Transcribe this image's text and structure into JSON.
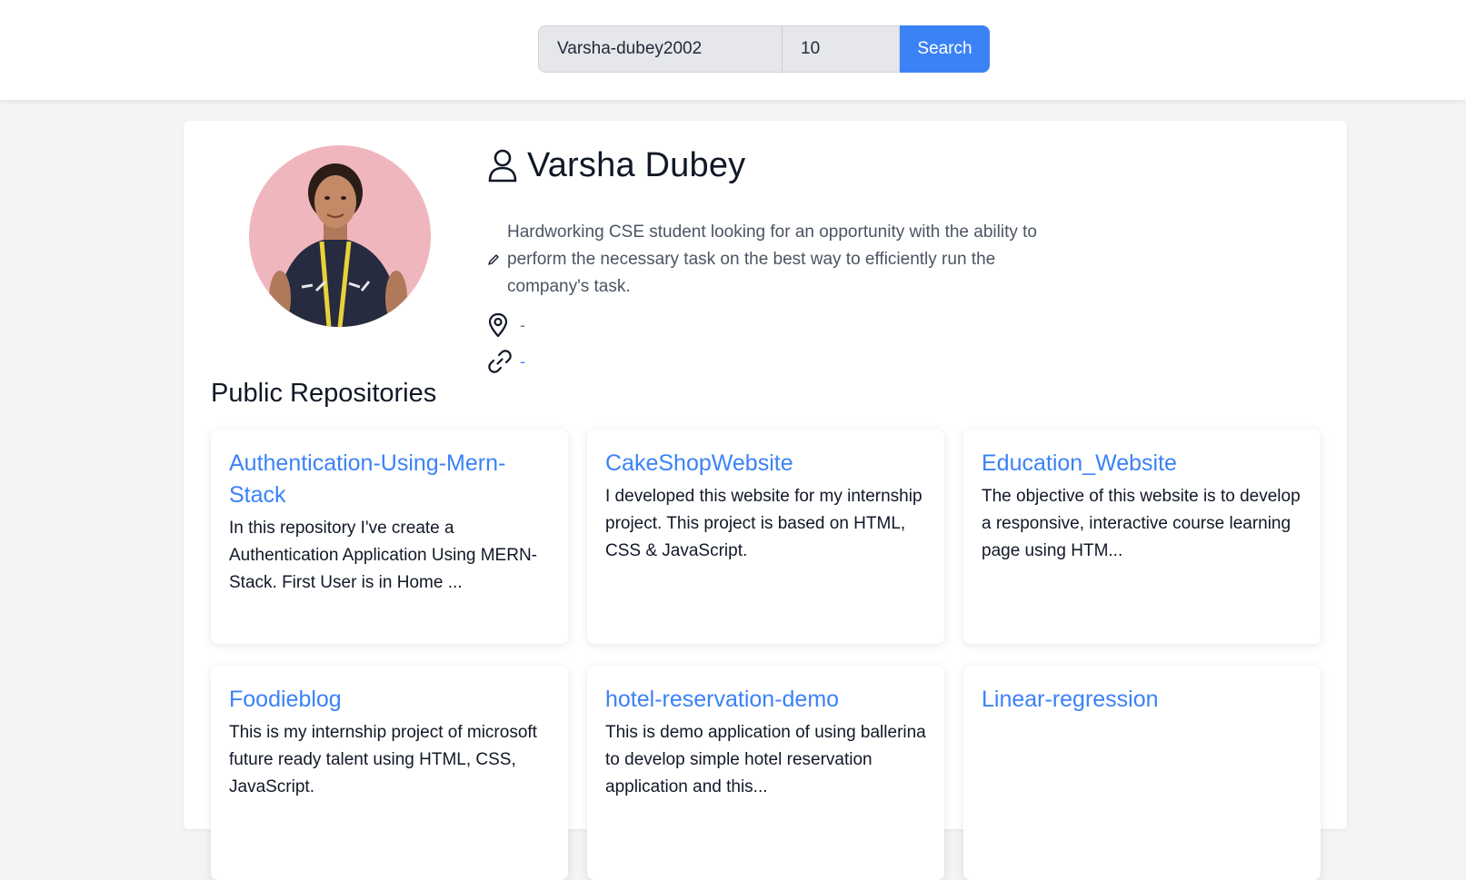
{
  "search": {
    "username_value": "Varsha-dubey2002",
    "count_value": "10",
    "button_label": "Search"
  },
  "profile": {
    "name": "Varsha Dubey",
    "bio": "Hardworking CSE student looking for an opportunity with the ability to perform the necessary task on the best way to efficiently run the company's task.",
    "location": "-",
    "website": "-"
  },
  "repos_section": {
    "title": "Public Repositories",
    "repos": [
      {
        "name": "Authentication-Using-Mern-Stack",
        "description": "In this repository I've create a Authentication Application Using MERN-Stack. First User is in Home ..."
      },
      {
        "name": "CakeShopWebsite",
        "description": "I developed this website for my internship project. This project is based on HTML, CSS & JavaScript."
      },
      {
        "name": "Education_Website",
        "description": "The objective of this website is to develop a responsive, interactive course learning page using HTM..."
      },
      {
        "name": "Foodieblog",
        "description": "This is my internship project of microsoft future ready talent using HTML, CSS, JavaScript."
      },
      {
        "name": "hotel-reservation-demo",
        "description": "This is demo application of using ballerina to develop simple hotel reservation application and this..."
      },
      {
        "name": "Linear-regression",
        "description": ""
      }
    ]
  },
  "colors": {
    "accent": "#3b82f6",
    "avatar_background": "#f0b6bd"
  }
}
